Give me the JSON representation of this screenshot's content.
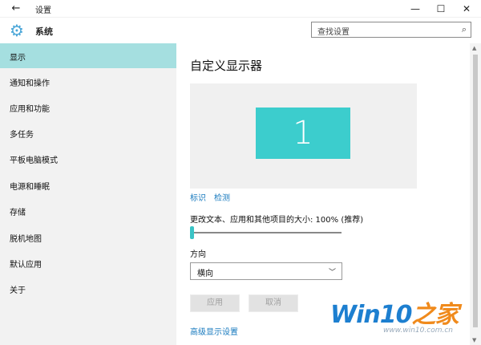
{
  "window": {
    "title": "设置",
    "back_icon": "arrow-left-icon",
    "minimize_glyph": "—",
    "maximize_glyph": "☐",
    "close_glyph": "✕"
  },
  "header": {
    "section": "系统",
    "icon": "gear-icon",
    "search_placeholder": "查找设置"
  },
  "sidebar": {
    "items": [
      {
        "label": "显示",
        "active": true
      },
      {
        "label": "通知和操作"
      },
      {
        "label": "应用和功能"
      },
      {
        "label": "多任务"
      },
      {
        "label": "平板电脑模式"
      },
      {
        "label": "电源和睡眠"
      },
      {
        "label": "存储"
      },
      {
        "label": "脱机地图"
      },
      {
        "label": "默认应用"
      },
      {
        "label": "关于"
      }
    ]
  },
  "main": {
    "title": "自定义显示器",
    "monitor_number": "1",
    "identify_link": "标识",
    "detect_link": "检测",
    "scale_label": "更改文本、应用和其他项目的大小: 100% (推荐)",
    "scale_value_percent": 100,
    "orientation_label": "方向",
    "orientation_value": "横向",
    "apply_button": "应用",
    "cancel_button": "取消",
    "advanced_link": "高级显示设置"
  },
  "watermark": {
    "brand_win": "Win10",
    "brand_suffix": "之家",
    "url": "www.win10.com.cn"
  },
  "colors": {
    "accent": "#3ccdcd",
    "sidebar_active": "#a5dfe0",
    "link": "#1a7bbf"
  }
}
